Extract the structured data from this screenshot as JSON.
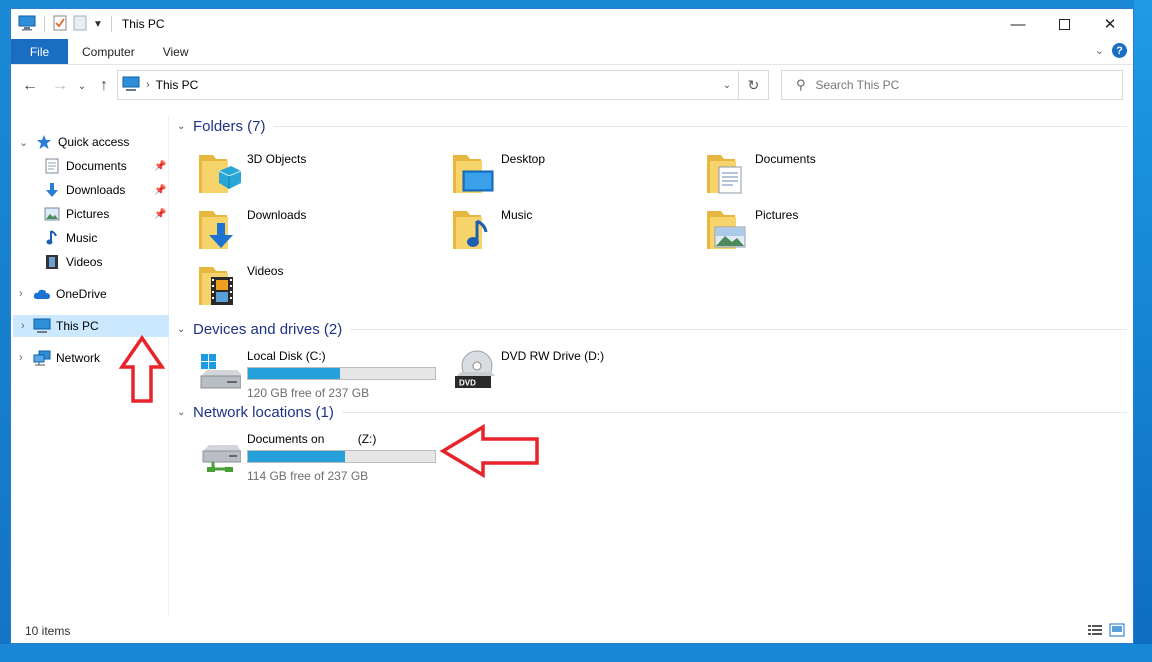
{
  "window": {
    "title": "This PC",
    "controls": [
      "minimize",
      "maximize",
      "close"
    ]
  },
  "ribbon": {
    "tabs": [
      {
        "label": "File",
        "active": true
      },
      {
        "label": "Computer"
      },
      {
        "label": "View"
      }
    ]
  },
  "address_bar": {
    "path": "This PC"
  },
  "search": {
    "placeholder": "Search This PC"
  },
  "nav_pane": {
    "quick_access": "Quick access",
    "quick_items": [
      {
        "label": "Documents",
        "icon": "documents-icon",
        "pinned": true
      },
      {
        "label": "Downloads",
        "icon": "downloads-icon",
        "pinned": true
      },
      {
        "label": "Pictures",
        "icon": "pictures-icon",
        "pinned": true
      },
      {
        "label": "Music",
        "icon": "music-icon",
        "pinned": false
      },
      {
        "label": "Videos",
        "icon": "videos-icon",
        "pinned": false
      }
    ],
    "onedrive": "OneDrive",
    "this_pc": "This PC",
    "network": "Network",
    "selected": "This PC"
  },
  "groups": {
    "folders": {
      "title": "Folders (7)",
      "items": [
        {
          "label": "3D Objects",
          "icon": "3d-objects-icon"
        },
        {
          "label": "Desktop",
          "icon": "desktop-icon"
        },
        {
          "label": "Documents",
          "icon": "documents-icon"
        },
        {
          "label": "Downloads",
          "icon": "downloads-icon"
        },
        {
          "label": "Music",
          "icon": "music-icon"
        },
        {
          "label": "Pictures",
          "icon": "pictures-icon"
        },
        {
          "label": "Videos",
          "icon": "videos-icon"
        }
      ]
    },
    "devices": {
      "title": "Devices and drives (2)",
      "local_disk": {
        "label": "Local Disk (C:)",
        "free": "120 GB free of 237 GB",
        "used_fraction": 0.49
      },
      "dvd": {
        "label": "DVD RW Drive (D:)"
      }
    },
    "network": {
      "title": "Network locations (1)",
      "share": {
        "label": "Documents on          (Z:)",
        "free": "114 GB free of 237 GB",
        "used_fraction": 0.52
      }
    }
  },
  "status": {
    "item_count": "10 items"
  },
  "colors": {
    "accent": "#1a6ec2",
    "drive_bar": "#26a0da",
    "selection": "#cce8ff",
    "group_title": "#1e3287",
    "annotation": "#e8232a"
  }
}
